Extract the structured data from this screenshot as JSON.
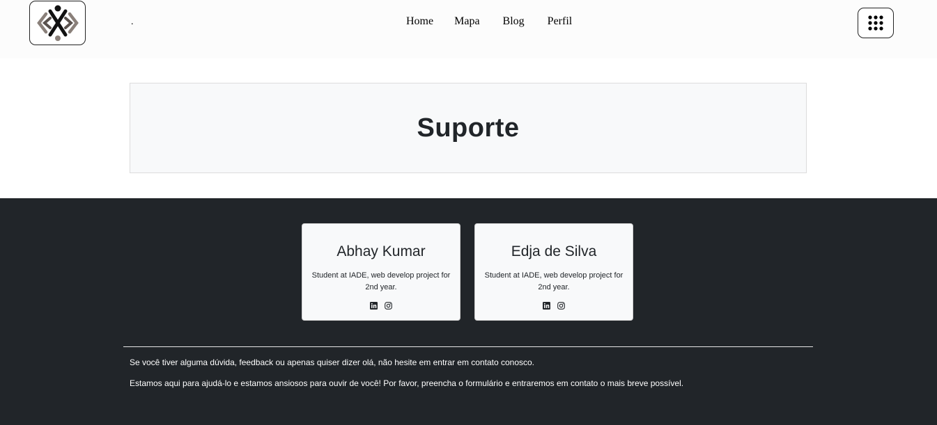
{
  "nav": {
    "separator": ".",
    "links": [
      "Home",
      "Mapa",
      "Blog",
      "Perfil"
    ]
  },
  "hero": {
    "title": "Suporte"
  },
  "team": [
    {
      "name": "Abhay Kumar",
      "description": "Student at IADE, web develop project for 2nd year.",
      "icons": [
        "linkedin-icon",
        "instagram-icon"
      ]
    },
    {
      "name": "Edja de Silva",
      "description": "Student at IADE, web develop project for 2nd year.",
      "icons": [
        "linkedin-icon",
        "instagram-icon"
      ]
    }
  ],
  "footer": {
    "line1": "Se você tiver alguma dúvida, feedback ou apenas quiser dizer olá, não hesite em entrar em contato conosco.",
    "line2": "Estamos aqui para ajudá-lo e estamos ansiosos para ouvir de você! Por favor, preencha o formulário e entraremos em contato o mais breve possível."
  },
  "colors": {
    "footer_bg": "#212529",
    "card_bg": "#f8f9fa",
    "hero_bg": "#f8f9fa"
  }
}
